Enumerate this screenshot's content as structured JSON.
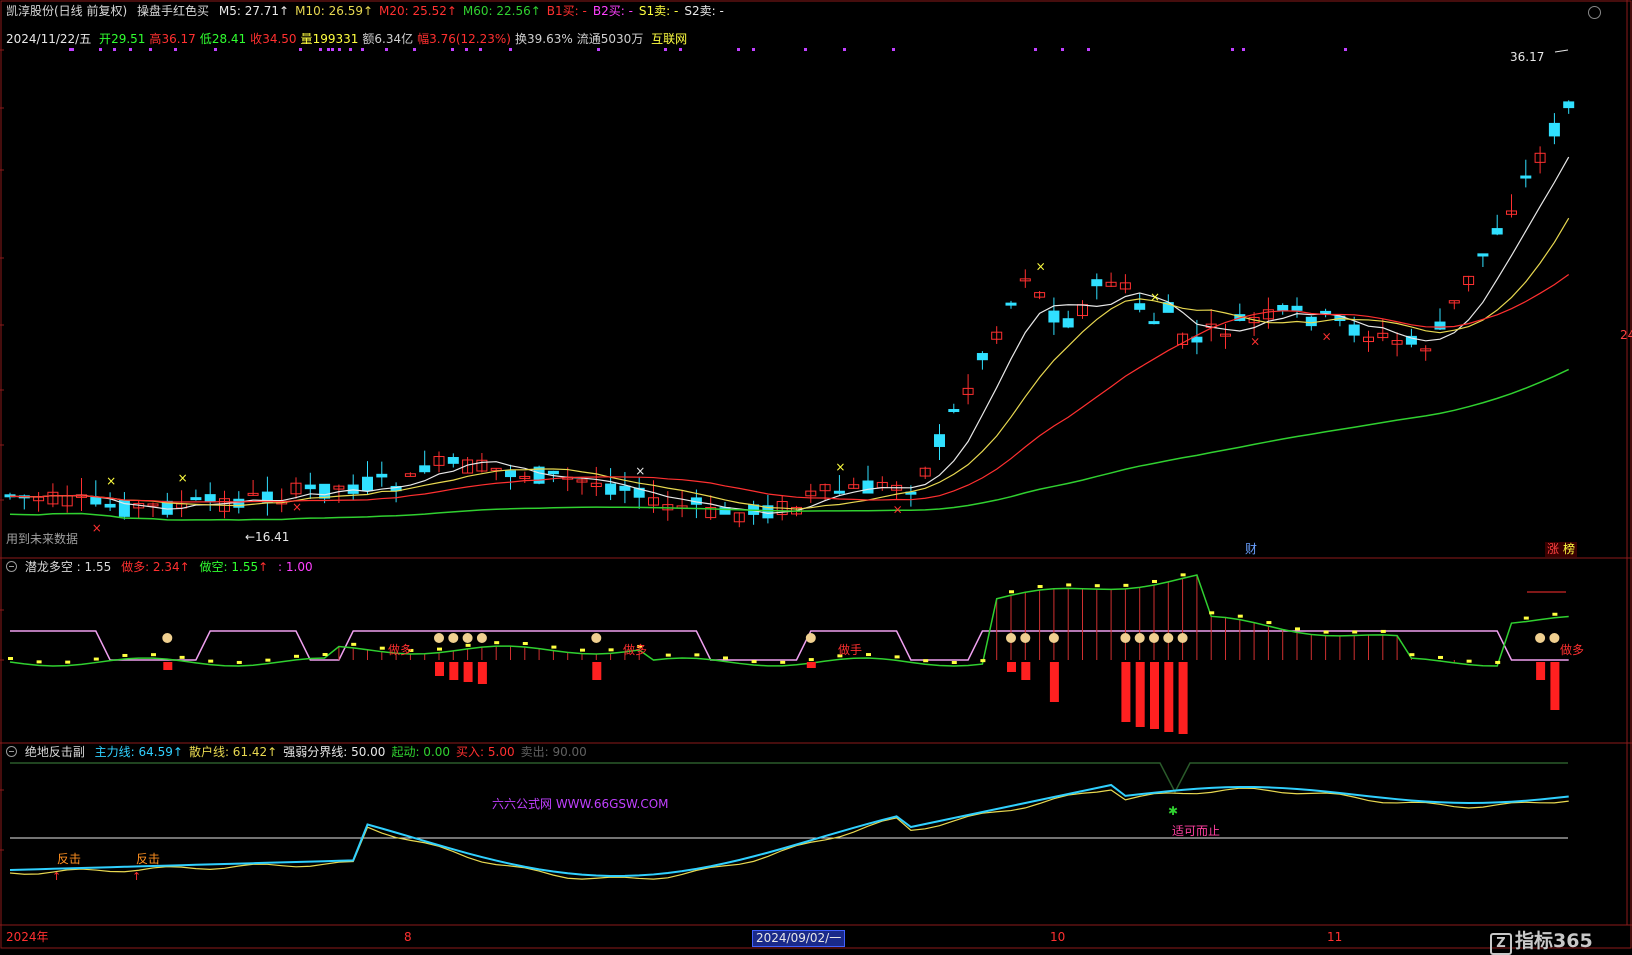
{
  "header": {
    "stock": "凯淳股份(日线 前复权)",
    "indicator": "操盘手红色买",
    "ma": [
      {
        "label": "M5: 27.71",
        "color": "#e8e8e8"
      },
      {
        "label": "M10: 26.59",
        "color": "#e8d850"
      },
      {
        "label": "M20: 25.52",
        "color": "#ff3030"
      },
      {
        "label": "M60: 22.56",
        "color": "#30d030"
      },
      {
        "label": "B1买: -",
        "color": "#ff3030"
      },
      {
        "label": "B2买: -",
        "color": "#ff40ff"
      },
      {
        "label": "S1卖: -",
        "color": "#ffff40"
      },
      {
        "label": "S2卖: -",
        "color": "#e8e8e8"
      }
    ],
    "arrow": "↑"
  },
  "quote": {
    "date": "2024/11/22/五",
    "items": [
      {
        "label": "开",
        "value": "29.51",
        "lc": "#30ff30",
        "vc": "#30ff30"
      },
      {
        "label": "高",
        "value": "36.17",
        "lc": "#ff3030",
        "vc": "#ff3030"
      },
      {
        "label": "低",
        "value": "28.41",
        "lc": "#30ff30",
        "vc": "#30ff30"
      },
      {
        "label": "收",
        "value": "34.50",
        "lc": "#ff3030",
        "vc": "#ff3030"
      },
      {
        "label": "量",
        "value": "199331",
        "lc": "#ffff40",
        "vc": "#ffff40"
      },
      {
        "label": "额",
        "value": "6.34亿",
        "lc": "#d0d0d0",
        "vc": "#d0d0d0"
      },
      {
        "label": "幅",
        "value": "3.76(12.23%)",
        "lc": "#ff3030",
        "vc": "#ff3030"
      },
      {
        "label": "换",
        "value": "39.63%",
        "lc": "#d0d0d0",
        "vc": "#d0d0d0"
      },
      {
        "label": "流通",
        "value": "5030万",
        "lc": "#d0d0d0",
        "vc": "#d0d0d0"
      }
    ],
    "sector": "互联网"
  },
  "main": {
    "peak_label": "36.17",
    "low_label": "←16.41",
    "future_note": "用到未来数据",
    "cai": "财",
    "zhang": "涨",
    "bang": "榜",
    "right_price": "24"
  },
  "sub1": {
    "title": "潜龙多空",
    "value1": ": 1.55",
    "zuo_duo": "做多: 2.34",
    "zuo_kong": "做空: 1.55",
    "extra": ": 1.00",
    "labels": {
      "a": "做多",
      "b": "做多",
      "c": "做手",
      "d": "做多"
    }
  },
  "sub2": {
    "title": "绝地反击副",
    "items": [
      {
        "label": "主力线: 64.59",
        "color": "#30d0ff"
      },
      {
        "label": "散户线: 61.42",
        "color": "#e8d850"
      },
      {
        "label": "强弱分界线: 50.00",
        "color": "#e8e8e8"
      },
      {
        "label": "起动: 0.00",
        "color": "#30d030"
      },
      {
        "label": "买入: 5.00",
        "color": "#ff3030"
      },
      {
        "label": "卖出: 90.00",
        "color": "#606060"
      }
    ],
    "watermark": "六六公式网 WWW.66GSW.COM",
    "fanji": "反击",
    "shike": "适可而止"
  },
  "xaxis": {
    "year": "2024年",
    "m8": "8",
    "m10": "10",
    "m11": "11",
    "cursor_date": "2024/09/02/一"
  },
  "brand": "指标365"
}
